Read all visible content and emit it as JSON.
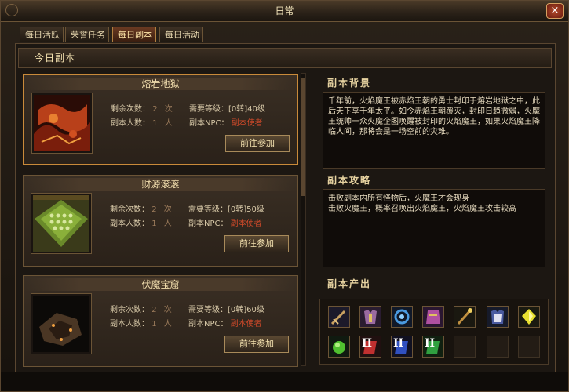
{
  "window": {
    "title": "日常",
    "close_label": "×"
  },
  "tabs": [
    {
      "label": "每日活跃",
      "active": false
    },
    {
      "label": "荣誉任务",
      "active": false
    },
    {
      "label": "每日副本",
      "active": true
    },
    {
      "label": "每日活动",
      "active": false
    }
  ],
  "section_header": "今日副本",
  "labels": {
    "remaining": "剩余次数：",
    "players": "副本人数：",
    "required": "需要等级：",
    "npc": "副本NPC：",
    "times_suffix": "次",
    "people_suffix": "人",
    "go_button": "前往参加"
  },
  "dungeons": [
    {
      "name": "熔岩地狱",
      "remaining": "2",
      "players": "1",
      "level": "[0转]40级",
      "npc": "副本使者",
      "selected": true
    },
    {
      "name": "财源滚滚",
      "remaining": "2",
      "players": "1",
      "level": "[0转]50级",
      "npc": "副本使者",
      "selected": false
    },
    {
      "name": "伏魔宝窟",
      "remaining": "2",
      "players": "1",
      "level": "[0转]60级",
      "npc": "副本使者",
      "selected": false
    }
  ],
  "background": {
    "title": "副本背景",
    "text": "千年前，火焰魔王被赤焰王朝的勇士封印于熔岩地狱之中，此后天下享千年太平。如今赤焰王朝覆灭，封印日趋微弱，火魔王统帅一众火魔企图唤醒被封印的火焰魔王，如果火焰魔王降临人间，那将会是一场空前的灾难。"
  },
  "strategy": {
    "title": "副本攻略",
    "line1": "击败副本内所有怪物后，火魔王才会现身",
    "line2": "击败火魔王，概率召唤出火焰魔王，火焰魔王攻击较高"
  },
  "rewards": {
    "title": "副本产出",
    "row1": [
      "sword-icon",
      "chest-armor-icon",
      "orb-icon",
      "robe-icon",
      "staff-icon",
      "armor-icon",
      "gem-icon"
    ],
    "row2": [
      "green-potion-icon",
      "skillbook-ii-red-icon",
      "skillbook-ii-blue-icon",
      "skillbook-ii-green-icon",
      "empty",
      "empty",
      "empty"
    ],
    "book_numeral": "II"
  },
  "colors": {
    "accent": "#c98a3a",
    "npc_red": "#d04a2a"
  }
}
